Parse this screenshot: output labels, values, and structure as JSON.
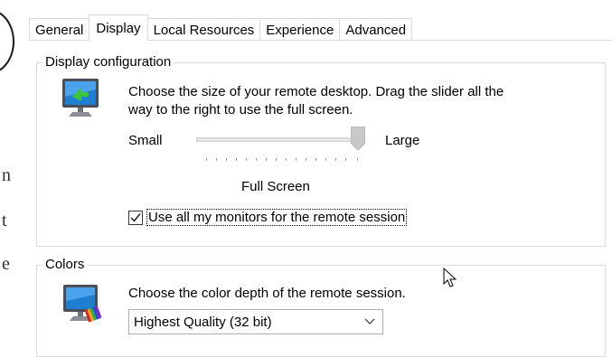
{
  "tabs": [
    {
      "label": "General",
      "active": false
    },
    {
      "label": "Display",
      "active": true
    },
    {
      "label": "Local Resources",
      "active": false
    },
    {
      "label": "Experience",
      "active": false
    },
    {
      "label": "Advanced",
      "active": false
    }
  ],
  "display_config": {
    "legend": "Display configuration",
    "description_line1": "Choose the size of your remote desktop. Drag the slider all the",
    "description_line2": "way to the right to use the full screen.",
    "slider_min_label": "Small",
    "slider_max_label": "Large",
    "slider_value_label": "Full Screen",
    "slider_position_fraction": 1.0,
    "monitors_checkbox_label": "Use all my monitors for the remote session",
    "monitors_checked": true
  },
  "colors": {
    "legend": "Colors",
    "description": "Choose the color depth of the remote session.",
    "selected_depth": "Highest Quality (32 bit)"
  },
  "icons": {
    "display": "monitor-display-icon",
    "colors": "monitor-colors-icon",
    "dropdown": "chevron-down-icon",
    "cursor": "mouse-pointer-icon"
  },
  "background_fragments": [
    "n",
    "t",
    "e"
  ]
}
